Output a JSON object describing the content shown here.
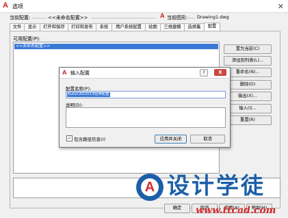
{
  "window": {
    "title": "选项"
  },
  "header": {
    "current_profile_label": "当前配置:",
    "current_profile_value": "<<未命名配置>>",
    "current_drawing_label": "当前图形:",
    "current_drawing_value": "Drawing1.dwg"
  },
  "tabs": [
    "文件",
    "显示",
    "打开和保存",
    "打印和发布",
    "系统",
    "用户系统配置",
    "绘图",
    "三维建模",
    "选择集",
    "配置"
  ],
  "active_tab": "配置",
  "profiles": {
    "label": "可用配置(P):",
    "items": [
      "<<未命名配置>>"
    ]
  },
  "side_buttons": [
    "置为当前(C)",
    "添加到列表(L)...",
    "重命名(N)...",
    "删除(D)",
    "输出(X)...",
    "输入(I)...",
    "重置(R)"
  ],
  "bottom_buttons": [
    "确定",
    "取消",
    "应用(A)",
    "帮助(H)"
  ],
  "dialog": {
    "title": "输入配置",
    "help_label": "?",
    "close_label": "X",
    "name_label": "配置名称(P):",
    "name_value": "AutoCAD2013经典配置",
    "desc_label": "说明(D):",
    "include_path_label": "包含路径信息(I)",
    "include_path_checked": true,
    "apply_close_label": "应用并关闭",
    "cancel_label": "取消"
  },
  "watermark": {
    "logo_letter": "A",
    "text": "设计学徒",
    "url": "www.ttcad.com"
  }
}
